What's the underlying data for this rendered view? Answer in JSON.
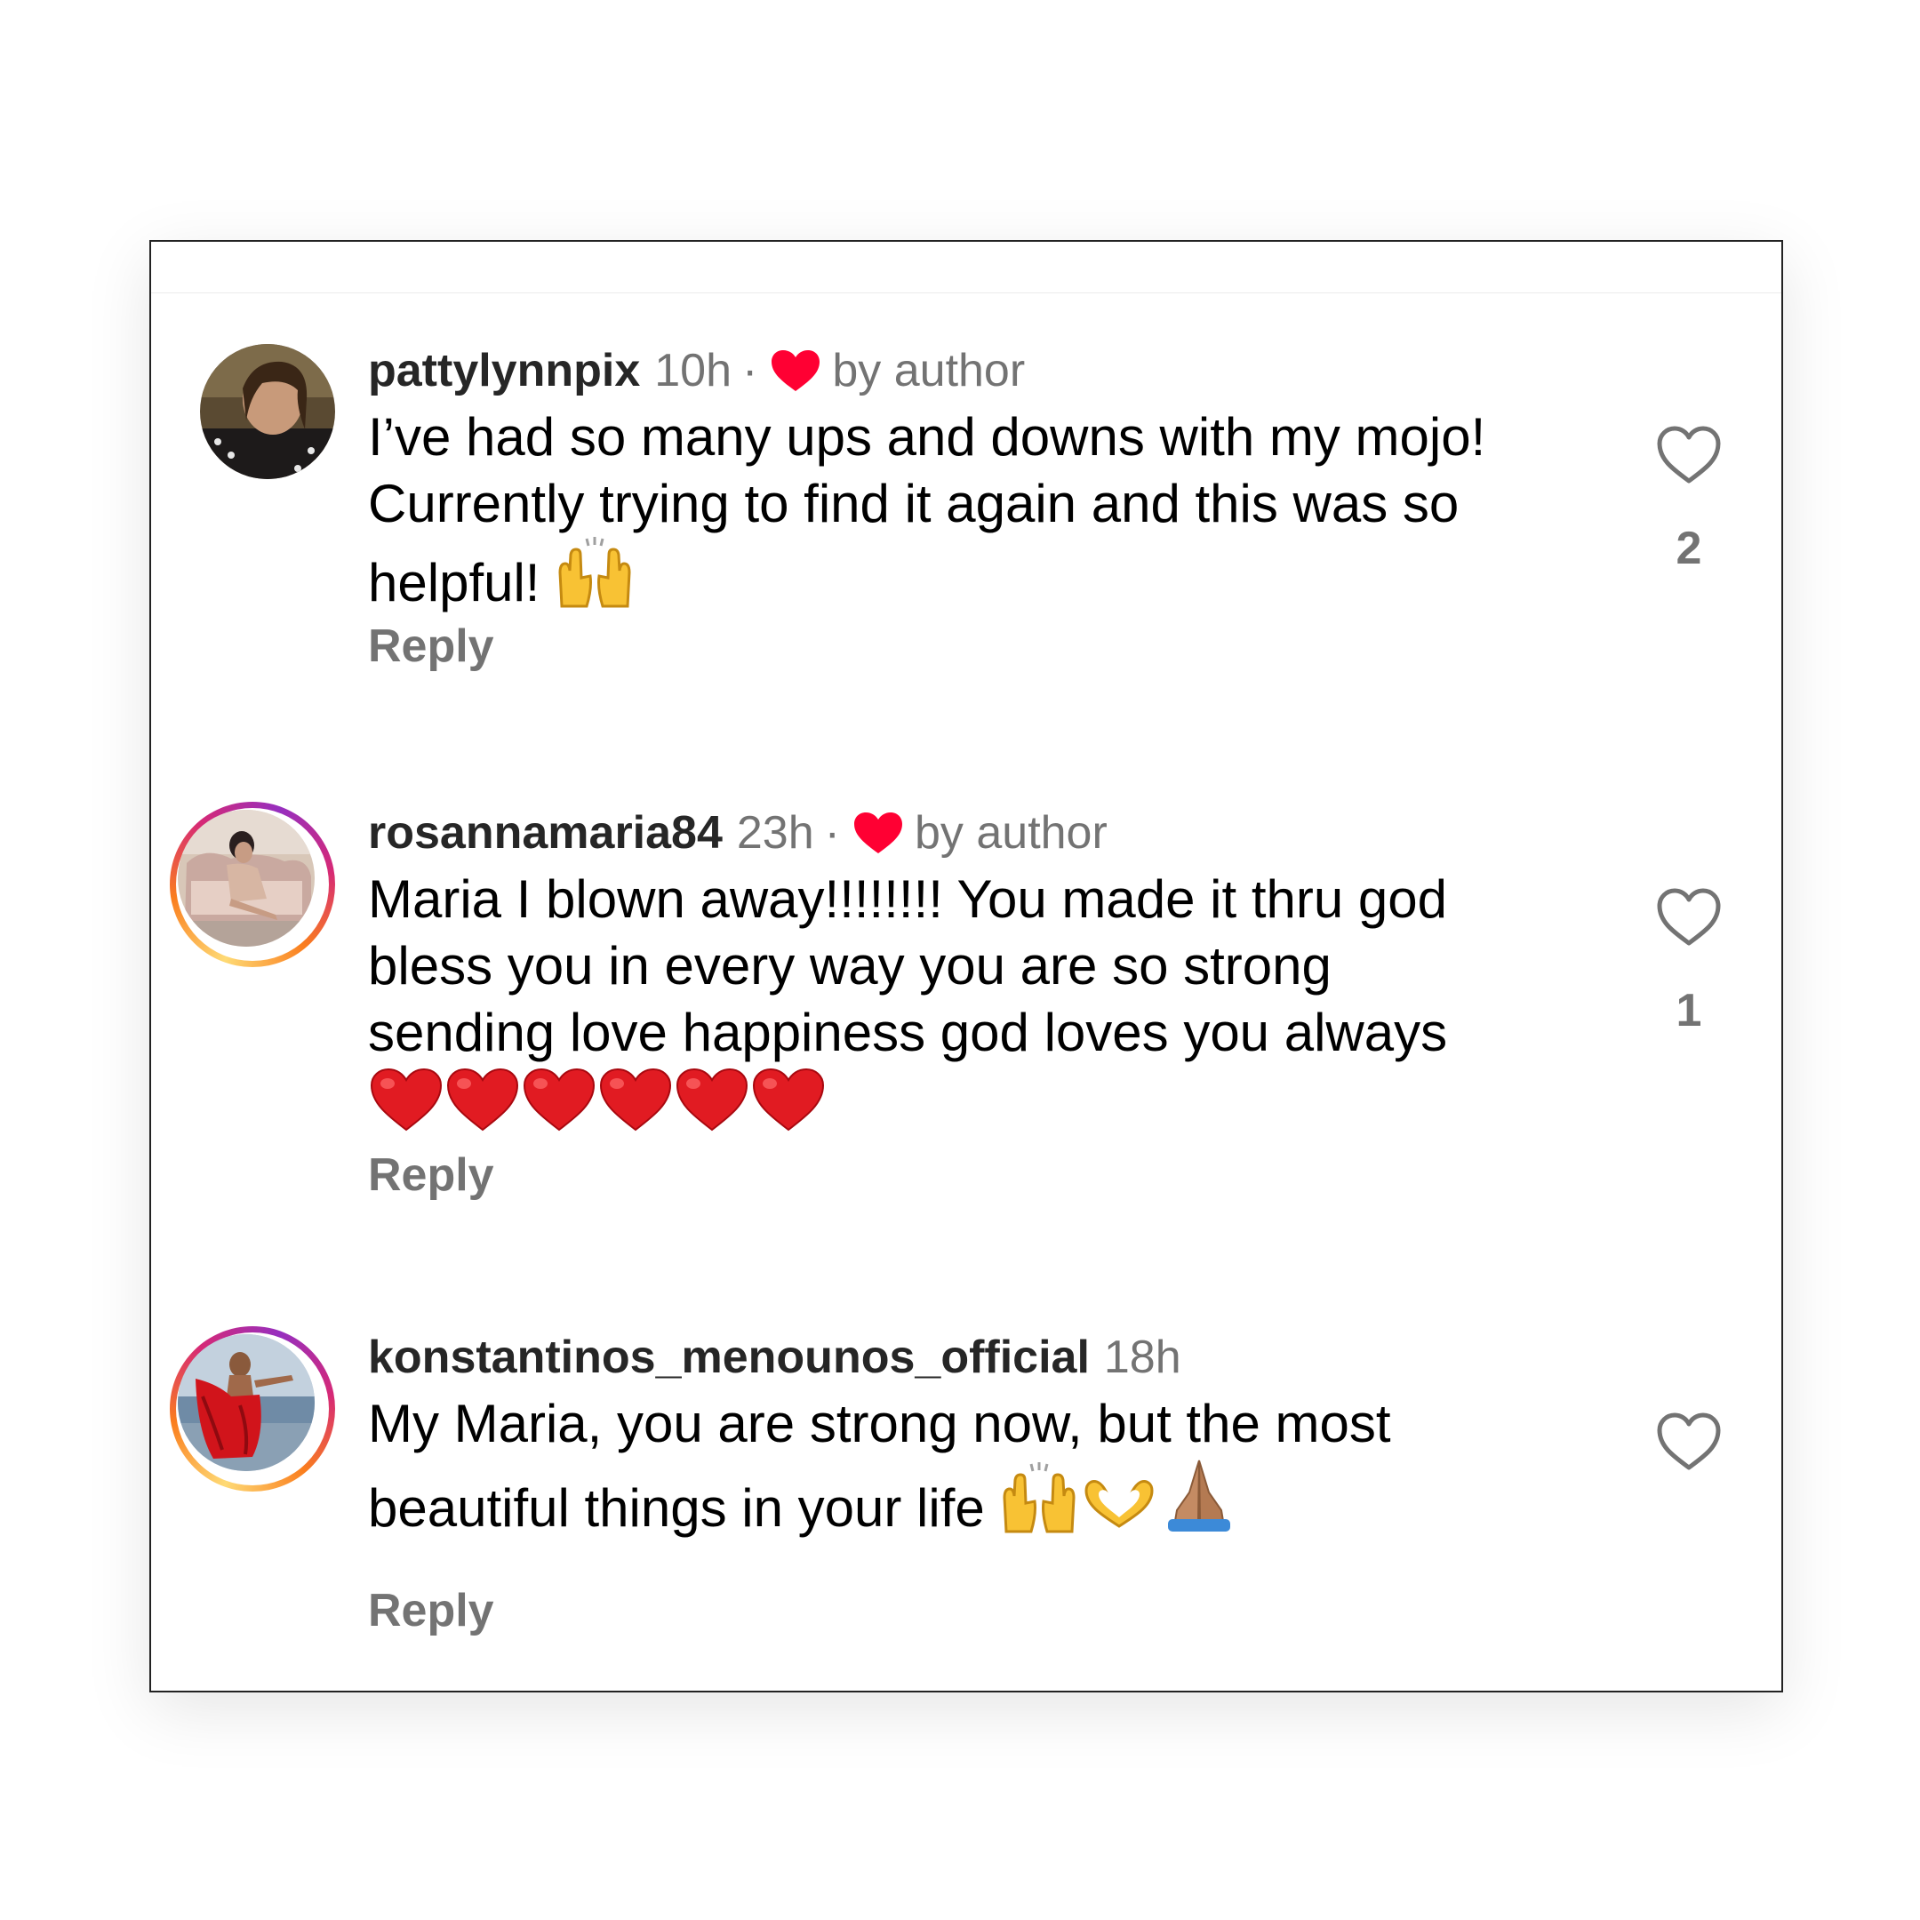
{
  "comments": [
    {
      "username": "pattylynnpix",
      "time": "10h",
      "separator": "·",
      "liked_by_author_label": "by author",
      "text": "I’ve had so many ups and downs with my mojo! Currently trying to find it again and this was so helpful! ",
      "emojis": [
        "raised-hands"
      ],
      "reply_label": "Reply",
      "like_count": "2",
      "avatar": {
        "story_ring": false
      }
    },
    {
      "username": "rosannamaria84",
      "time": "23h",
      "separator": "·",
      "liked_by_author_label": "by author",
      "text": "Maria I blown away!!!!!!!! You made it thru god bless you in every way you are so strong sending love happiness god loves you always ",
      "emojis": [
        "red-heart",
        "red-heart",
        "red-heart",
        "red-heart",
        "red-heart",
        "red-heart"
      ],
      "reply_label": "Reply",
      "like_count": "1",
      "avatar": {
        "story_ring": true
      }
    },
    {
      "username": "konstantinos_menounos_official",
      "time": "18h",
      "text": "My Maria, you are strong now, but the most beautiful things in your life ",
      "emojis": [
        "raised-hands",
        "heart-hands",
        "folded-hands"
      ],
      "reply_label": "Reply",
      "like_count": "",
      "avatar": {
        "story_ring": true
      }
    }
  ],
  "colors": {
    "author_heart": "#ff0033",
    "secondary_text": "#737373",
    "primary_text": "#000000",
    "username": "#262626"
  }
}
